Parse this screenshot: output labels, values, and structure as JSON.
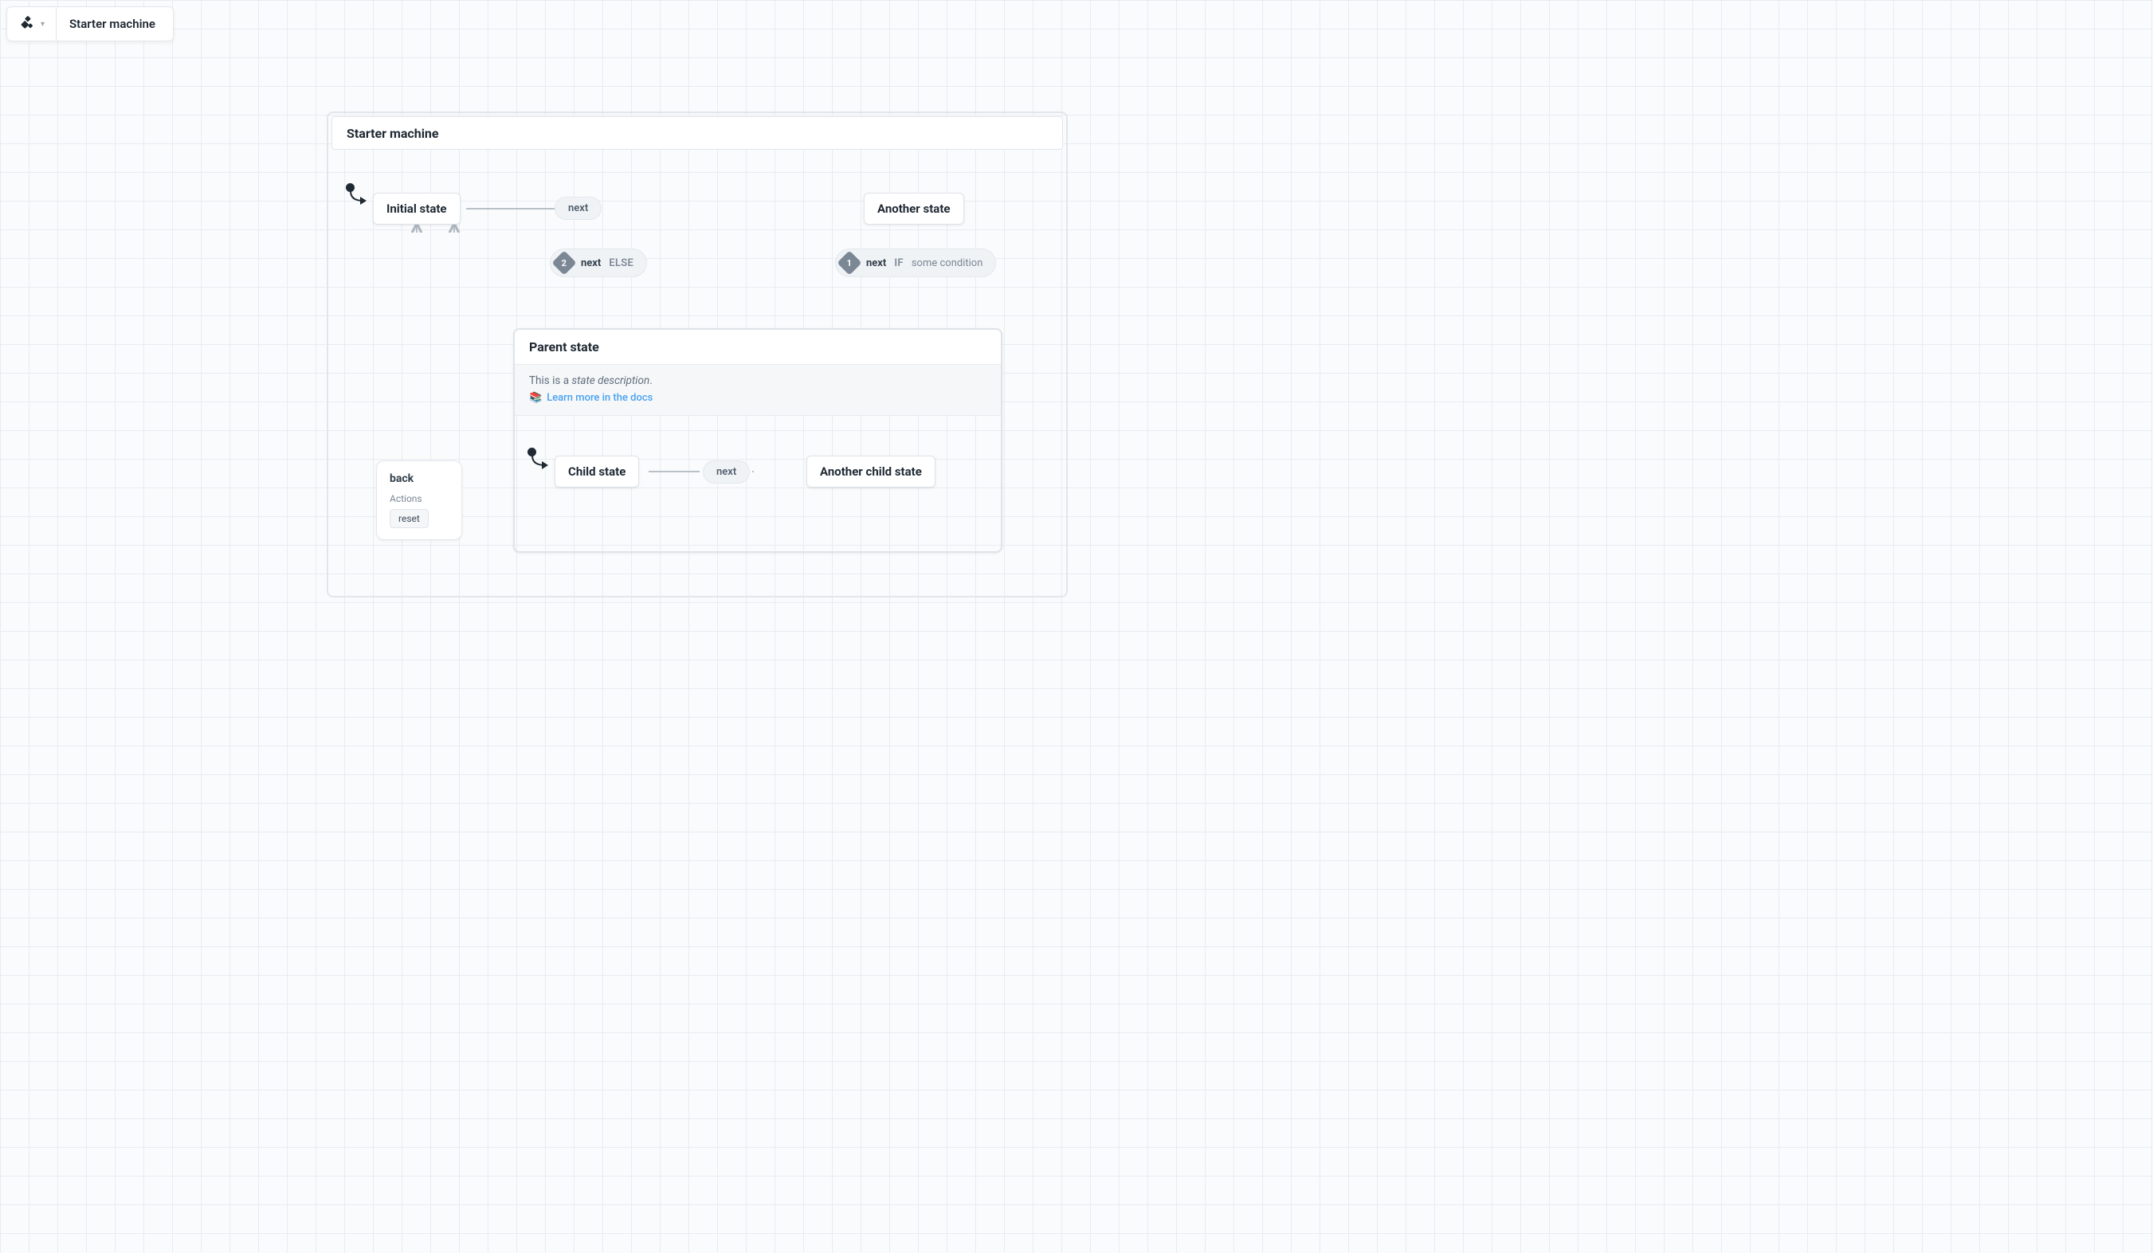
{
  "toolbar": {
    "title": "Starter machine"
  },
  "machine": {
    "title": "Starter machine",
    "states": {
      "initial": "Initial state",
      "another": "Another state",
      "parent": {
        "title": "Parent state",
        "description_prefix": "This is a ",
        "description_em": "state description",
        "description_suffix": ".",
        "doc_link_label": "Learn more in the docs",
        "children": {
          "child": "Child state",
          "another_child": "Another child state",
          "child_event": "next"
        }
      }
    },
    "transitions": {
      "initial_to_another": "next",
      "guard1": {
        "num": "1",
        "event": "next",
        "keyword": "IF",
        "condition": "some condition"
      },
      "guard2": {
        "num": "2",
        "event": "next",
        "keyword": "ELSE"
      },
      "back_card": {
        "event": "back",
        "actions_label": "Actions",
        "action": "reset"
      }
    }
  }
}
